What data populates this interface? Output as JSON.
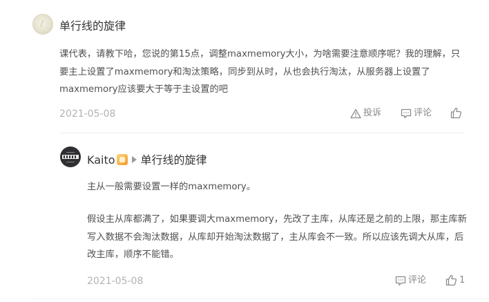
{
  "comment": {
    "username": "单行线的旋律",
    "text": "课代表，请教下哈，您说的第15点，调整maxmemory大小，为啥需要注意顺序呢？我的理解，只要主上设置了maxmemory和淘汰策略，同步到从时，从也会执行淘汰，从服务器上设置了maxmemory应该要大于等于主设置的吧",
    "date": "2021-05-08",
    "report_label": "投诉",
    "comment_label": "评论"
  },
  "reply": {
    "username": "Kaito",
    "reply_to": "单行线的旋律",
    "paragraph1": "主从一般需要设置一样的maxmemory。",
    "paragraph2": "假设主从库都满了，如果要调大maxmemory，先改了主库，从库还是之前的上限，那主库新写入数据不会淘汰数据，从库却开始淘汰数据了，主从库会不一致。所以应该先调大从库，后改主库，顺序不能错。",
    "date": "2021-05-08",
    "comment_label": "评论",
    "like_count": "1"
  },
  "colors": {
    "text_primary": "#353535",
    "text_secondary": "#505050",
    "meta": "#b2b2b2",
    "action": "#888888"
  },
  "icons": {
    "report": "warning-triangle-icon",
    "comment": "speech-bubble-icon",
    "like": "thumbs-up-icon",
    "badge": "vip-badge-icon",
    "reply_arrow": "play-arrow-icon"
  }
}
